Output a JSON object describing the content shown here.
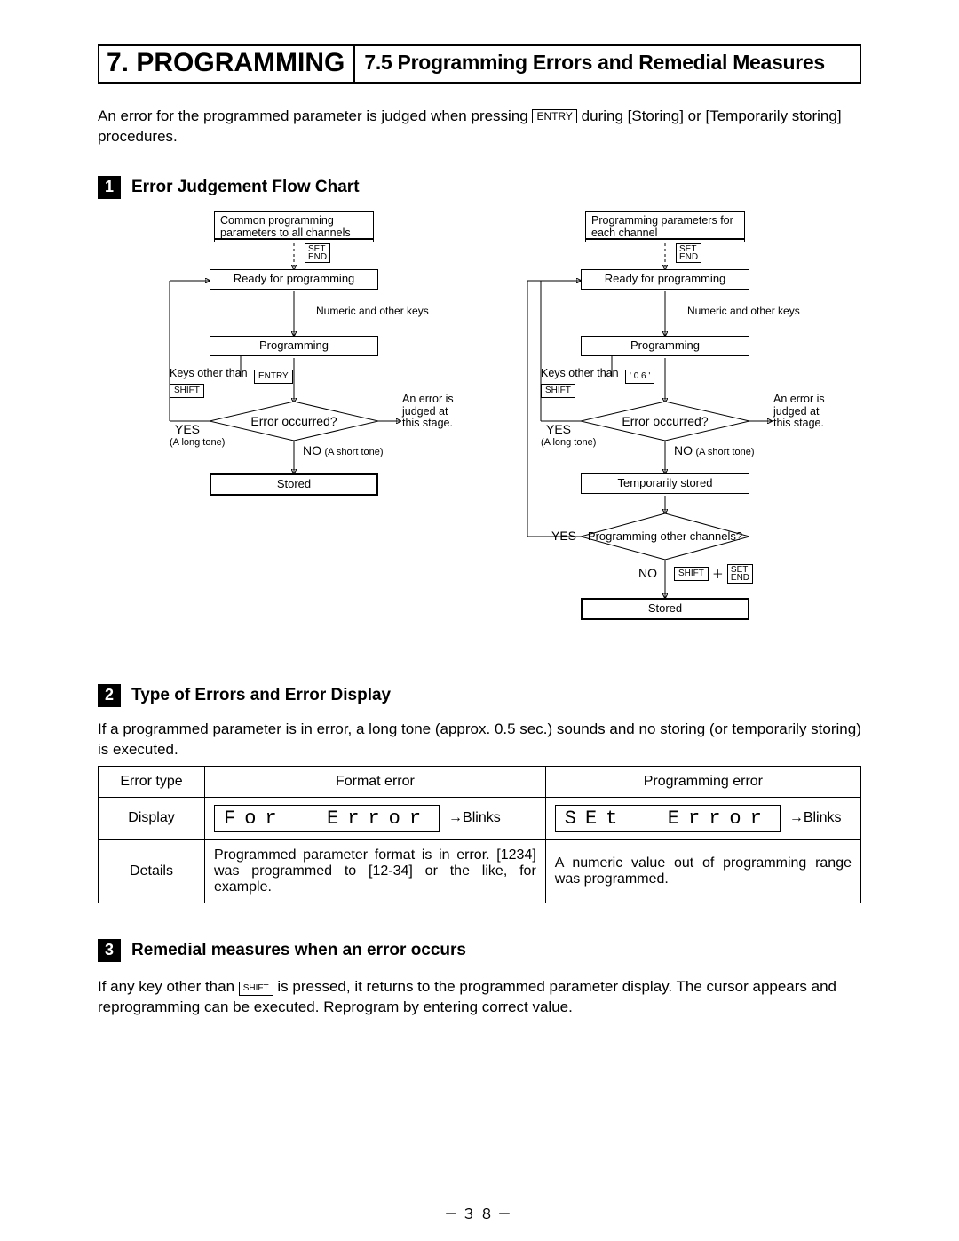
{
  "header": {
    "chapter": "7. PROGRAMMING",
    "section": "7.5 Programming Errors and Remedial Measures"
  },
  "intro": {
    "p1a": "An error for the programmed parameter is judged when pressing ",
    "key_entry": "ENTRY",
    "p1b": " during [Storing] or [Temporarily storing] procedures."
  },
  "section1": {
    "num": "1",
    "title": "Error Judgement Flow Chart",
    "flow_left": {
      "top": "Common programming parameters to all channels",
      "setend_top": "SET",
      "setend_bot": "END",
      "ready": "Ready for programming",
      "numkeys": "Numeric and other keys",
      "programming": "Programming",
      "keys_other": "Keys other than",
      "shift": "SHIFT",
      "entry": "ENTRY",
      "error_q": "Error occurred?",
      "err_note": "An error is judged at this stage.",
      "yes": "YES",
      "yes_sub": "(A long tone)",
      "no": "NO",
      "no_sub": "(A short tone)",
      "stored": "Stored"
    },
    "flow_right": {
      "top": "Programming parameters for each channel",
      "setend_top": "SET",
      "setend_bot": "END",
      "ready": "Ready for programming",
      "numkeys": "Numeric and other keys",
      "programming": "Programming",
      "keys_other": "Keys other than",
      "shift": "SHIFT",
      "disp06": "' 0 6 '",
      "error_q": "Error occurred?",
      "err_note": "An error is judged at this stage.",
      "yes": "YES",
      "yes_sub": "(A long tone)",
      "no": "NO",
      "no_sub": "(A short tone)",
      "tempstored": "Temporarily stored",
      "other_q": "Programming other channels?",
      "yes2": "YES",
      "no2": "NO",
      "shift2": "SHIFT",
      "plus": "＋",
      "setend2_top": "SET",
      "setend2_bot": "END",
      "stored": "Stored"
    }
  },
  "section2": {
    "num": "2",
    "title": "Type of Errors and Error Display",
    "intro": "If a programmed parameter is in error, a long tone (approx. 0.5 sec.) sounds and no storing (or temporarily storing) is executed.",
    "table": {
      "h1": "Error type",
      "h2": "Format error",
      "h3": "Programming error",
      "r2c1": "Display",
      "r2c2_seg": "For  Error",
      "r2c2_tail": "→Blinks",
      "r2c3_seg": "SEt  Error",
      "r2c3_tail": "→Blinks",
      "r3c1": "Details",
      "r3c2": "Programmed parameter format is in error. [1234] was programmed to [12-34] or the like, for example.",
      "r3c3": "A numeric value out of programming range was programmed."
    }
  },
  "section3": {
    "num": "3",
    "title": "Remedial measures when an error occurs",
    "p_a": "If any key other than ",
    "key_shift": "SHIFT",
    "p_b": " is pressed, it returns to the programmed parameter display. The cursor appears and reprogramming can be executed. Reprogram by entering correct value."
  },
  "page_num": "－３８－"
}
